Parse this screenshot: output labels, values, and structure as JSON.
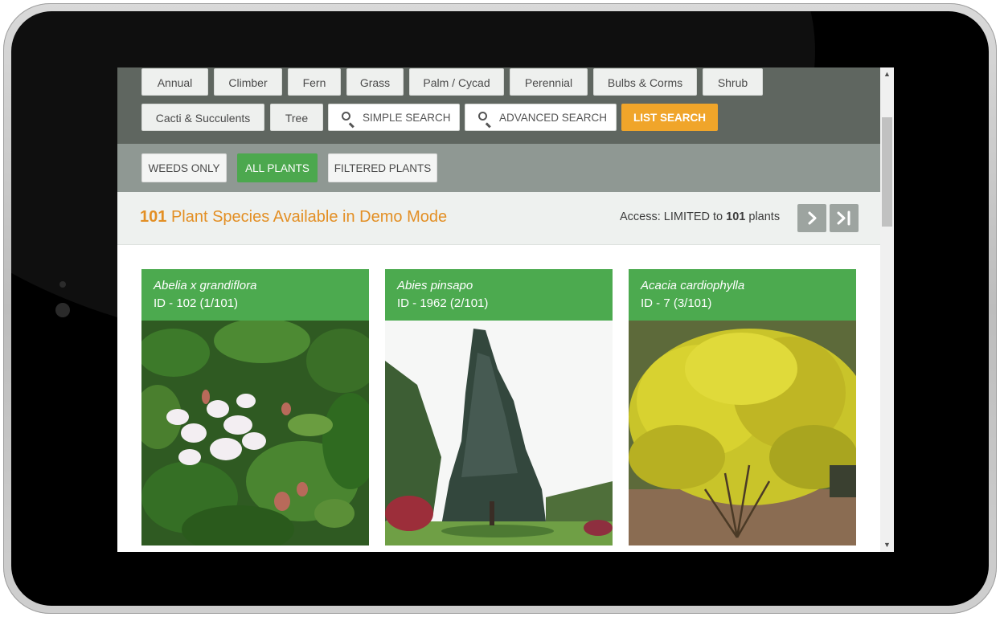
{
  "plant_types": [
    "Annual",
    "Climber",
    "Fern",
    "Grass",
    "Palm / Cycad",
    "Perennial",
    "Bulbs & Corms",
    "Shrub",
    "Cacti & Succulents",
    "Tree"
  ],
  "search": {
    "simple": "SIMPLE SEARCH",
    "advanced": "ADVANCED SEARCH",
    "list": "LIST SEARCH"
  },
  "filters": {
    "weeds_only": "WEEDS ONLY",
    "all_plants": "ALL PLANTS",
    "filtered_plants": "FILTERED PLANTS",
    "active": "ALL PLANTS"
  },
  "header": {
    "count": "101",
    "title_rest": "Plant Species Available in Demo Mode",
    "access_prefix": "Access: LIMITED to",
    "access_count": "101",
    "access_suffix": "plants"
  },
  "cards": [
    {
      "name": "Abelia x grandiflora",
      "id": "ID - 102 (1/101)"
    },
    {
      "name": "Abies pinsapo",
      "id": "ID - 1962 (2/101)"
    },
    {
      "name": "Acacia cardiophylla",
      "id": "ID - 7 (3/101)"
    }
  ],
  "icons": {
    "search": "search-icon",
    "next": "chevron-right-icon",
    "last": "last-page-icon",
    "scroll_up": "scroll-up-arrow-icon",
    "scroll_down": "scroll-down-arrow-icon"
  },
  "colors": {
    "accent_orange": "#f0a52a",
    "title_orange": "#e38f24",
    "green": "#4caa4f",
    "type_bar": "#5f6660",
    "filter_bar": "#8f9893"
  }
}
